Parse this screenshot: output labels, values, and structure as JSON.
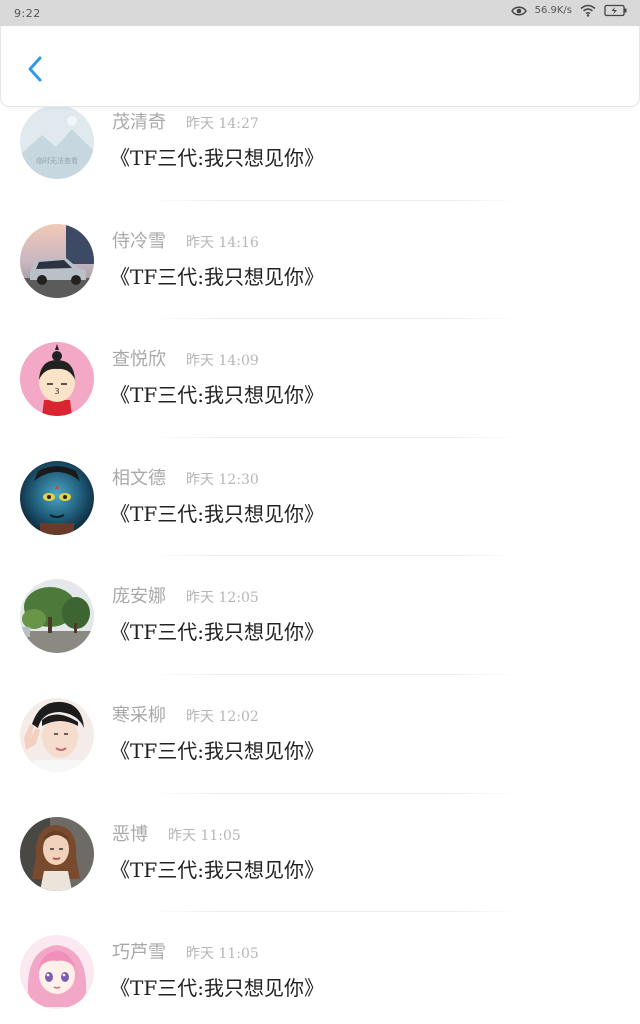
{
  "status_bar": {
    "time": "9:22",
    "speed": "56.9K/s"
  },
  "header": {
    "back_icon": "chevron-left-icon",
    "accent_color": "#2f9ae8"
  },
  "messages": [
    {
      "name": "茂清奇",
      "time": "昨天 14:27",
      "text": "《TF三代:我只想见你》",
      "avatar": "placeholder-image-avatar",
      "avatar_caption": "临时无法查看"
    },
    {
      "name": "侍冷雪",
      "time": "昨天 14:16",
      "text": "《TF三代:我只想见你》",
      "avatar": "car-photo-avatar"
    },
    {
      "name": "查悦欣",
      "time": "昨天 14:09",
      "text": "《TF三代:我只想见你》",
      "avatar": "cartoon-girl-avatar"
    },
    {
      "name": "相文德",
      "time": "昨天 12:30",
      "text": "《TF三代:我只想见你》",
      "avatar": "avatar-movie-character-avatar"
    },
    {
      "name": "庞安娜",
      "time": "昨天 12:05",
      "text": "《TF三代:我只想见你》",
      "avatar": "trees-landscape-avatar"
    },
    {
      "name": "寒采柳",
      "time": "昨天 12:02",
      "text": "《TF三代:我只想见你》",
      "avatar": "young-man-peace-sign-avatar"
    },
    {
      "name": "恶博",
      "time": "昨天 11:05",
      "text": "《TF三代:我只想见你》",
      "avatar": "woman-portrait-avatar"
    },
    {
      "name": "巧芦雪",
      "time": "昨天 11:05",
      "text": "《TF三代:我只想见你》",
      "avatar": "anime-girl-avatar"
    }
  ]
}
